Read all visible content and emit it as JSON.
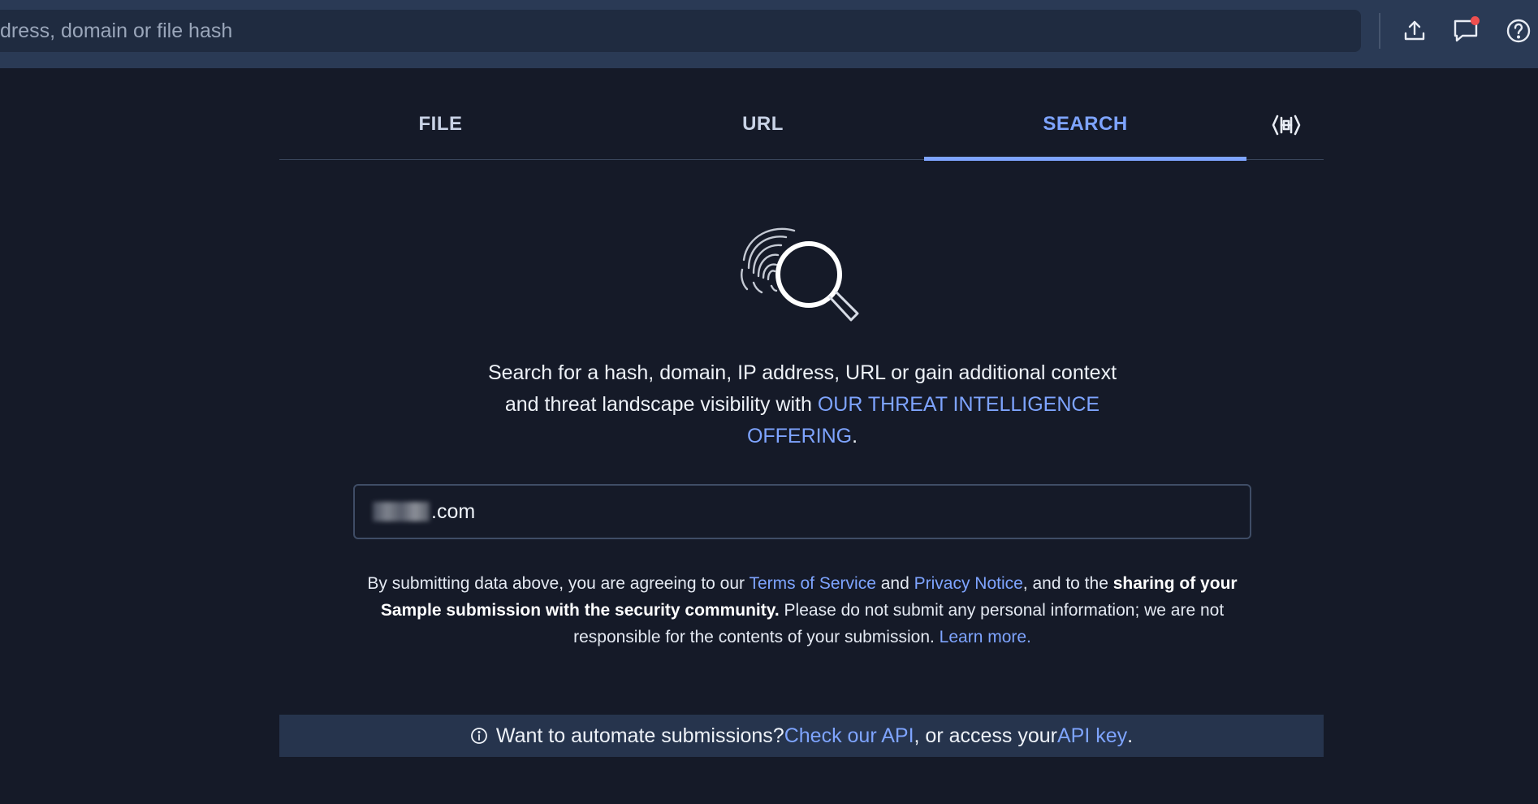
{
  "topbar": {
    "search_placeholder": "dress, domain or file hash",
    "icons": [
      "upload-icon",
      "chat-notification-icon",
      "help-icon"
    ]
  },
  "tabs": [
    {
      "label": "FILE",
      "active": false
    },
    {
      "label": "URL",
      "active": false
    },
    {
      "label": "SEARCH",
      "active": true
    }
  ],
  "tab_extra_icon": "code-brackets-icon",
  "intro": {
    "text_before": "Search for a hash, domain, IP address, URL or gain additional context and threat landscape visibility with ",
    "link": "OUR THREAT INTELLIGENCE OFFERING",
    "text_after": "."
  },
  "search_input": {
    "value": ".com"
  },
  "terms": {
    "p1": "By submitting data above, you are agreeing to our ",
    "tos": "Terms of Service",
    "and": " and ",
    "privacy": "Privacy Notice",
    "p2": ", and to the ",
    "bold": "sharing of your Sample submission with the security community.",
    "p3": " Please do not submit any personal information; we are not responsible for the contents of your submission. ",
    "learn": "Learn more."
  },
  "api_banner": {
    "text1": "Want to automate submissions? ",
    "link1": "Check our API",
    "text2": ", or access your ",
    "link2": "API key",
    "text3": "."
  },
  "colors": {
    "background": "#151a28",
    "topbar": "#2a3a55",
    "accent": "#7ea4ff",
    "notification": "#ef4f4f"
  }
}
